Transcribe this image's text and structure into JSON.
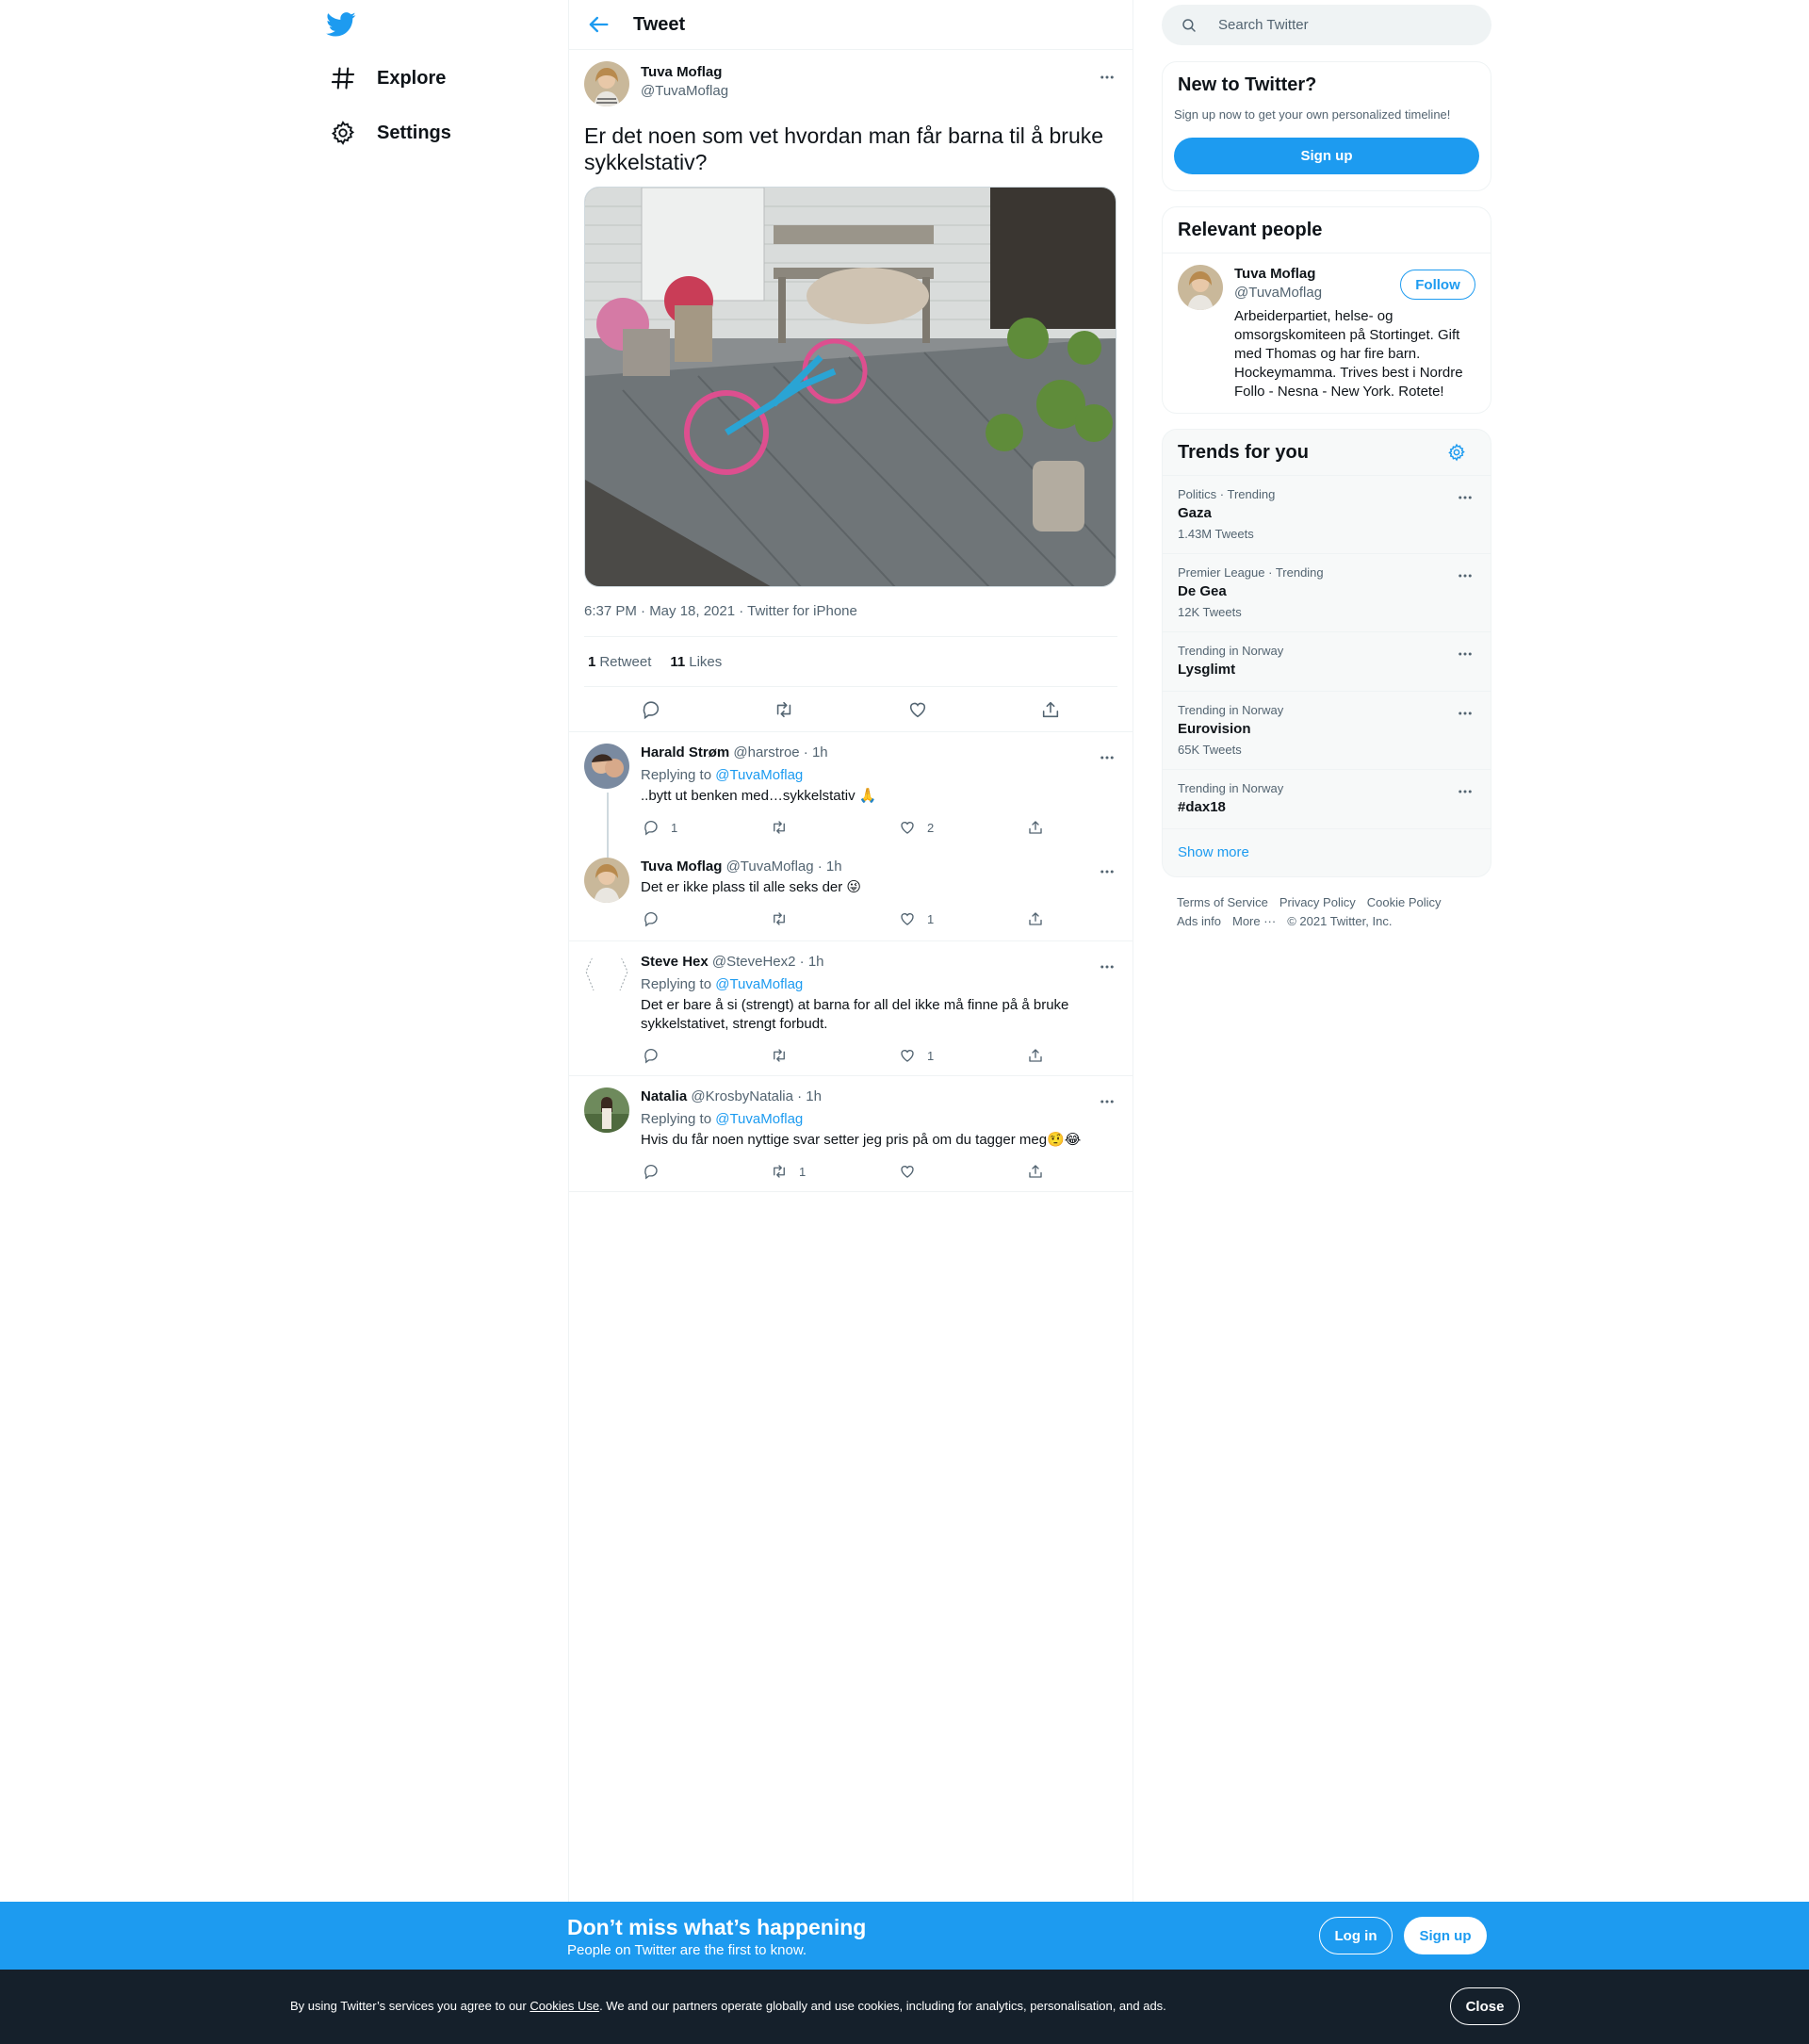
{
  "colors": {
    "accent": "#1d9bf0",
    "text": "#0f1419",
    "secondary": "#536471",
    "border": "#eff3f4",
    "cookie_bg": "#15202b"
  },
  "nav": {
    "logo_icon": "twitter-bird-icon",
    "items": [
      {
        "label": "Explore",
        "icon": "hashtag-icon"
      },
      {
        "label": "Settings",
        "icon": "gear-icon"
      }
    ]
  },
  "header": {
    "title": "Tweet",
    "back_icon": "arrow-left-icon"
  },
  "tweet": {
    "name": "Tuva Moflag",
    "handle": "@TuvaMoflag",
    "text": "Er det noen som vet hvordan man får barna til å bruke sykkelstativ?",
    "timestamp": "6:37 PM · May 18, 2021 · Twitter for iPhone",
    "retweets": "1",
    "retweets_label": "Retweet",
    "likes": "11",
    "likes_label": "Likes"
  },
  "replies": [
    {
      "name": "Harald Strøm",
      "handle": "@harstroe · 1h",
      "replying_prefix": "Replying to ",
      "replying_to": "@TuvaMoflag",
      "text": "..bytt ut benken med…sykkelstativ 🙏",
      "reply_count": "1",
      "retweet_count": "",
      "like_count": "2"
    },
    {
      "name": "Tuva Moflag",
      "handle": "@TuvaMoflag · 1h",
      "text": "Det er ikke plass til alle seks der 😜",
      "reply_count": "",
      "retweet_count": "",
      "like_count": "1"
    },
    {
      "name": "Steve Hex",
      "handle": "@SteveHex2 · 1h",
      "replying_prefix": "Replying to ",
      "replying_to": "@TuvaMoflag",
      "text": "Det er bare å si (strengt) at barna for all del ikke må finne på å bruke sykkelstativet, strengt forbudt.",
      "reply_count": "",
      "retweet_count": "",
      "like_count": "1"
    },
    {
      "name": "Natalia",
      "handle": "@KrosbyNatalia · 1h",
      "replying_prefix": "Replying to ",
      "replying_to": "@TuvaMoflag",
      "text": "Hvis du får noen nyttige svar setter jeg pris på om du tagger meg🤨😂",
      "reply_count": "",
      "retweet_count": "1",
      "like_count": ""
    }
  ],
  "right": {
    "search_placeholder": "Search Twitter",
    "new_to_twitter": {
      "title": "New to Twitter?",
      "subtitle": "Sign up now to get your own personalized timeline!",
      "button": "Sign up"
    },
    "relevant": {
      "title": "Relevant people",
      "name": "Tuva Moflag",
      "handle": "@TuvaMoflag",
      "follow": "Follow",
      "bio": "Arbeiderpartiet, helse- og omsorgskomiteen på Stortinget. Gift med Thomas og har fire barn. Hockeymamma. Trives best i Nordre Follo - Nesna - New York. Rotete!"
    },
    "trends": {
      "title": "Trends for you",
      "items": [
        {
          "category": "Politics · Trending",
          "name": "Gaza",
          "count": "1.43M Tweets"
        },
        {
          "category": "Premier League · Trending",
          "name": "De Gea",
          "count": "12K Tweets"
        },
        {
          "category": "Trending in Norway",
          "name": "Lysglimt",
          "count": ""
        },
        {
          "category": "Trending in Norway",
          "name": "Eurovision",
          "count": "65K Tweets"
        },
        {
          "category": "Trending in Norway",
          "name": "#dax18",
          "count": ""
        }
      ],
      "show_more": "Show more"
    },
    "footer": {
      "links": [
        "Terms of Service",
        "Privacy Policy",
        "Cookie Policy",
        "Ads info",
        "More ···",
        "© 2021 Twitter, Inc."
      ]
    }
  },
  "promo": {
    "title": "Don’t miss what’s happening",
    "subtitle": "People on Twitter are the first to know.",
    "login": "Log in",
    "signup": "Sign up"
  },
  "cookie": {
    "prefix": "By using Twitter’s services you agree to our ",
    "link": "Cookies Use",
    "suffix": ". We and our partners operate globally and use cookies, including for analytics, personalisation, and ads.",
    "close": "Close"
  }
}
